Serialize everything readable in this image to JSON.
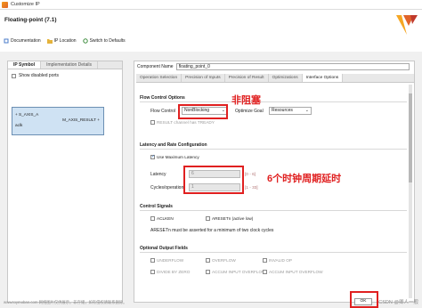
{
  "window": {
    "title": "Customize IP"
  },
  "app": {
    "heading": "Floating-point (7.1)"
  },
  "toolbar": [
    {
      "label": "Documentation",
      "icon": "book-icon"
    },
    {
      "label": "IP Location",
      "icon": "folder-icon"
    },
    {
      "label": "Switch to Defaults",
      "icon": "refresh-icon"
    }
  ],
  "left": {
    "tabs": [
      "IP Symbol",
      "Implementation Details"
    ],
    "show_disabled": "Show disabled ports",
    "symbol": {
      "port_a": "S_AXIS_A",
      "aclk": "aclk",
      "port_result": "M_AXIS_RESULT"
    }
  },
  "right": {
    "component_label": "Component Name",
    "component_value": "floating_point_0",
    "tabs": [
      "Operation Selection",
      "Precision of Inputs",
      "Precision of Result",
      "Optimizations",
      "Interface Options"
    ],
    "active_tab": 4,
    "flow_control": {
      "title": "Flow Control Options",
      "label": "Flow Control",
      "value": "NonBlocking",
      "opt_goal_label": "Optimize Goal",
      "opt_goal_value": "Resources",
      "result_tready": "RESULT channel has TREADY"
    },
    "latency": {
      "title": "Latency and Rate Configuration",
      "use_max": "Use Maximum Latency",
      "latency_label": "Latency",
      "latency_value": "6",
      "latency_range": "[0 - 6]",
      "cycles_label": "Cycles/operation",
      "cycles_value": "1",
      "cycles_range": "[1 - 33]"
    },
    "control": {
      "title": "Control Signals",
      "aclken": "ACLKEN",
      "aresetn": "ARESETn (active low)",
      "note": "ARESETn must be asserted for a minimum of two clock cycles"
    },
    "optional": {
      "title": "Optional Output Fields",
      "items": [
        "UNDERFLOW",
        "OVERFLOW",
        "INVALID OP",
        "DIVIDE BY ZERO",
        "ACCUM INPUT OVERFLOW",
        "ACCUM INPUT OVERFLOW"
      ]
    }
  },
  "annotations": {
    "nonblocking": "非阻塞",
    "latency": "6个时钟周期延时"
  },
  "buttons": {
    "ok": "OK"
  },
  "watermark": {
    "footer": "www.toymoban.com 网络图片仅供展示，非存储，如有侵权请联系删除。",
    "csdn": "CSDN @卿人一般"
  },
  "colors": {
    "annotation": "#e02020",
    "symbol_fill": "#cfe2f3",
    "accent": "#e0632a"
  }
}
